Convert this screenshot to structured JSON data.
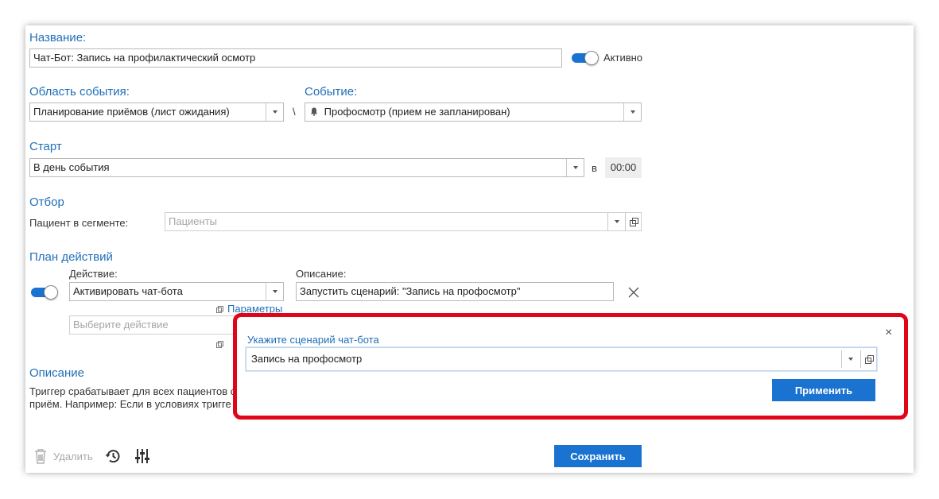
{
  "name_section": {
    "label": "Название:",
    "value": "Чат-Бот: Запись на профилактический осмотр",
    "active_label": "Активно"
  },
  "event_area": {
    "label": "Область события:",
    "value": "Планирование приёмов (лист ожидания)"
  },
  "separator": "\\",
  "event": {
    "label": "Событие:",
    "value": "Профосмотр (прием не запланирован)"
  },
  "start": {
    "label": "Старт",
    "value": "В день события",
    "at_label": "в",
    "time": "00:00"
  },
  "filter": {
    "label": "Отбор",
    "segment_label": "Пациент в сегменте:",
    "segment_placeholder": "Пациенты"
  },
  "action_plan": {
    "label": "План действий",
    "action_label": "Действие:",
    "action_value": "Активировать чат-бота",
    "params_link": "Параметры",
    "description_label": "Описание:",
    "description_value": "Запустить сценарий: \"Запись на профосмотр\"",
    "new_action_placeholder": "Выберите действие"
  },
  "description": {
    "label": "Описание",
    "line1": "Триггер срабатывает для всех пациентов с",
    "line2": "приём. Например: Если в условиях тригге"
  },
  "footer": {
    "delete_label": "Удалить",
    "save_label": "Сохранить"
  },
  "popup": {
    "label": "Укажите сценарий чат-бота",
    "value": "Запись на профосмотр",
    "apply_label": "Применить",
    "close_symbol": "×"
  },
  "colors": {
    "accent": "#1a73d1",
    "section_text": "#1f6fb8",
    "highlight": "#e0061a"
  }
}
